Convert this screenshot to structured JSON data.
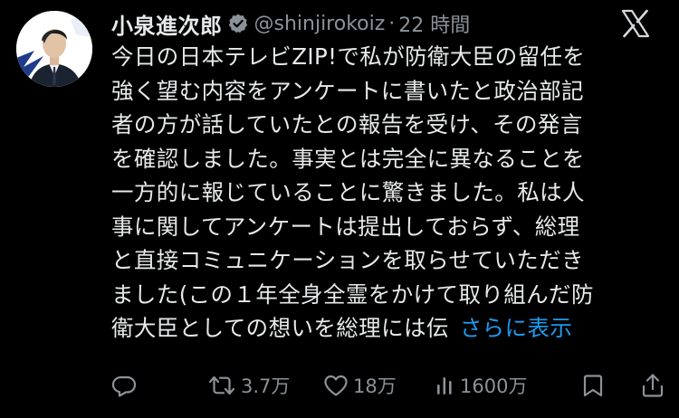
{
  "author": {
    "display_name": "小泉進次郎",
    "handle": "@shinjirokoiz",
    "separator": "·",
    "time": "22 時間",
    "verified": true,
    "verified_color": "#8b9299"
  },
  "tweet": {
    "lines": [
      "今日の日本テレビZIP!で私が防衛大臣の留任を",
      "強く望む内容をアンケートに書いたと政治部記",
      "者の方が話していたとの報告を受け、その発言",
      "を確認しました。事実とは完全に異なることを",
      "一方的に報じていることに驚きました。私は人",
      "事に関してアンケートは提出しておらず、総理",
      "と直接コミュニケーションを取らせていただき",
      "ました(この１年全身全霊をかけて取り組んだ防",
      "衛大臣としての想いを総理には伝"
    ],
    "show_more": "さらに表示"
  },
  "actions": {
    "reply": {
      "icon": "reply-icon",
      "count": ""
    },
    "retweet": {
      "icon": "retweet-icon",
      "count": "3.7万"
    },
    "like": {
      "icon": "heart-icon",
      "count": "18万"
    },
    "views": {
      "icon": "views-icon",
      "count": "1600万"
    },
    "bookmark": {
      "icon": "bookmark-icon",
      "count": ""
    },
    "share": {
      "icon": "share-icon",
      "count": ""
    }
  },
  "colors": {
    "background": "#000000",
    "text": "#e7e9ea",
    "secondary": "#8b9299",
    "link": "#1d9bf0"
  }
}
